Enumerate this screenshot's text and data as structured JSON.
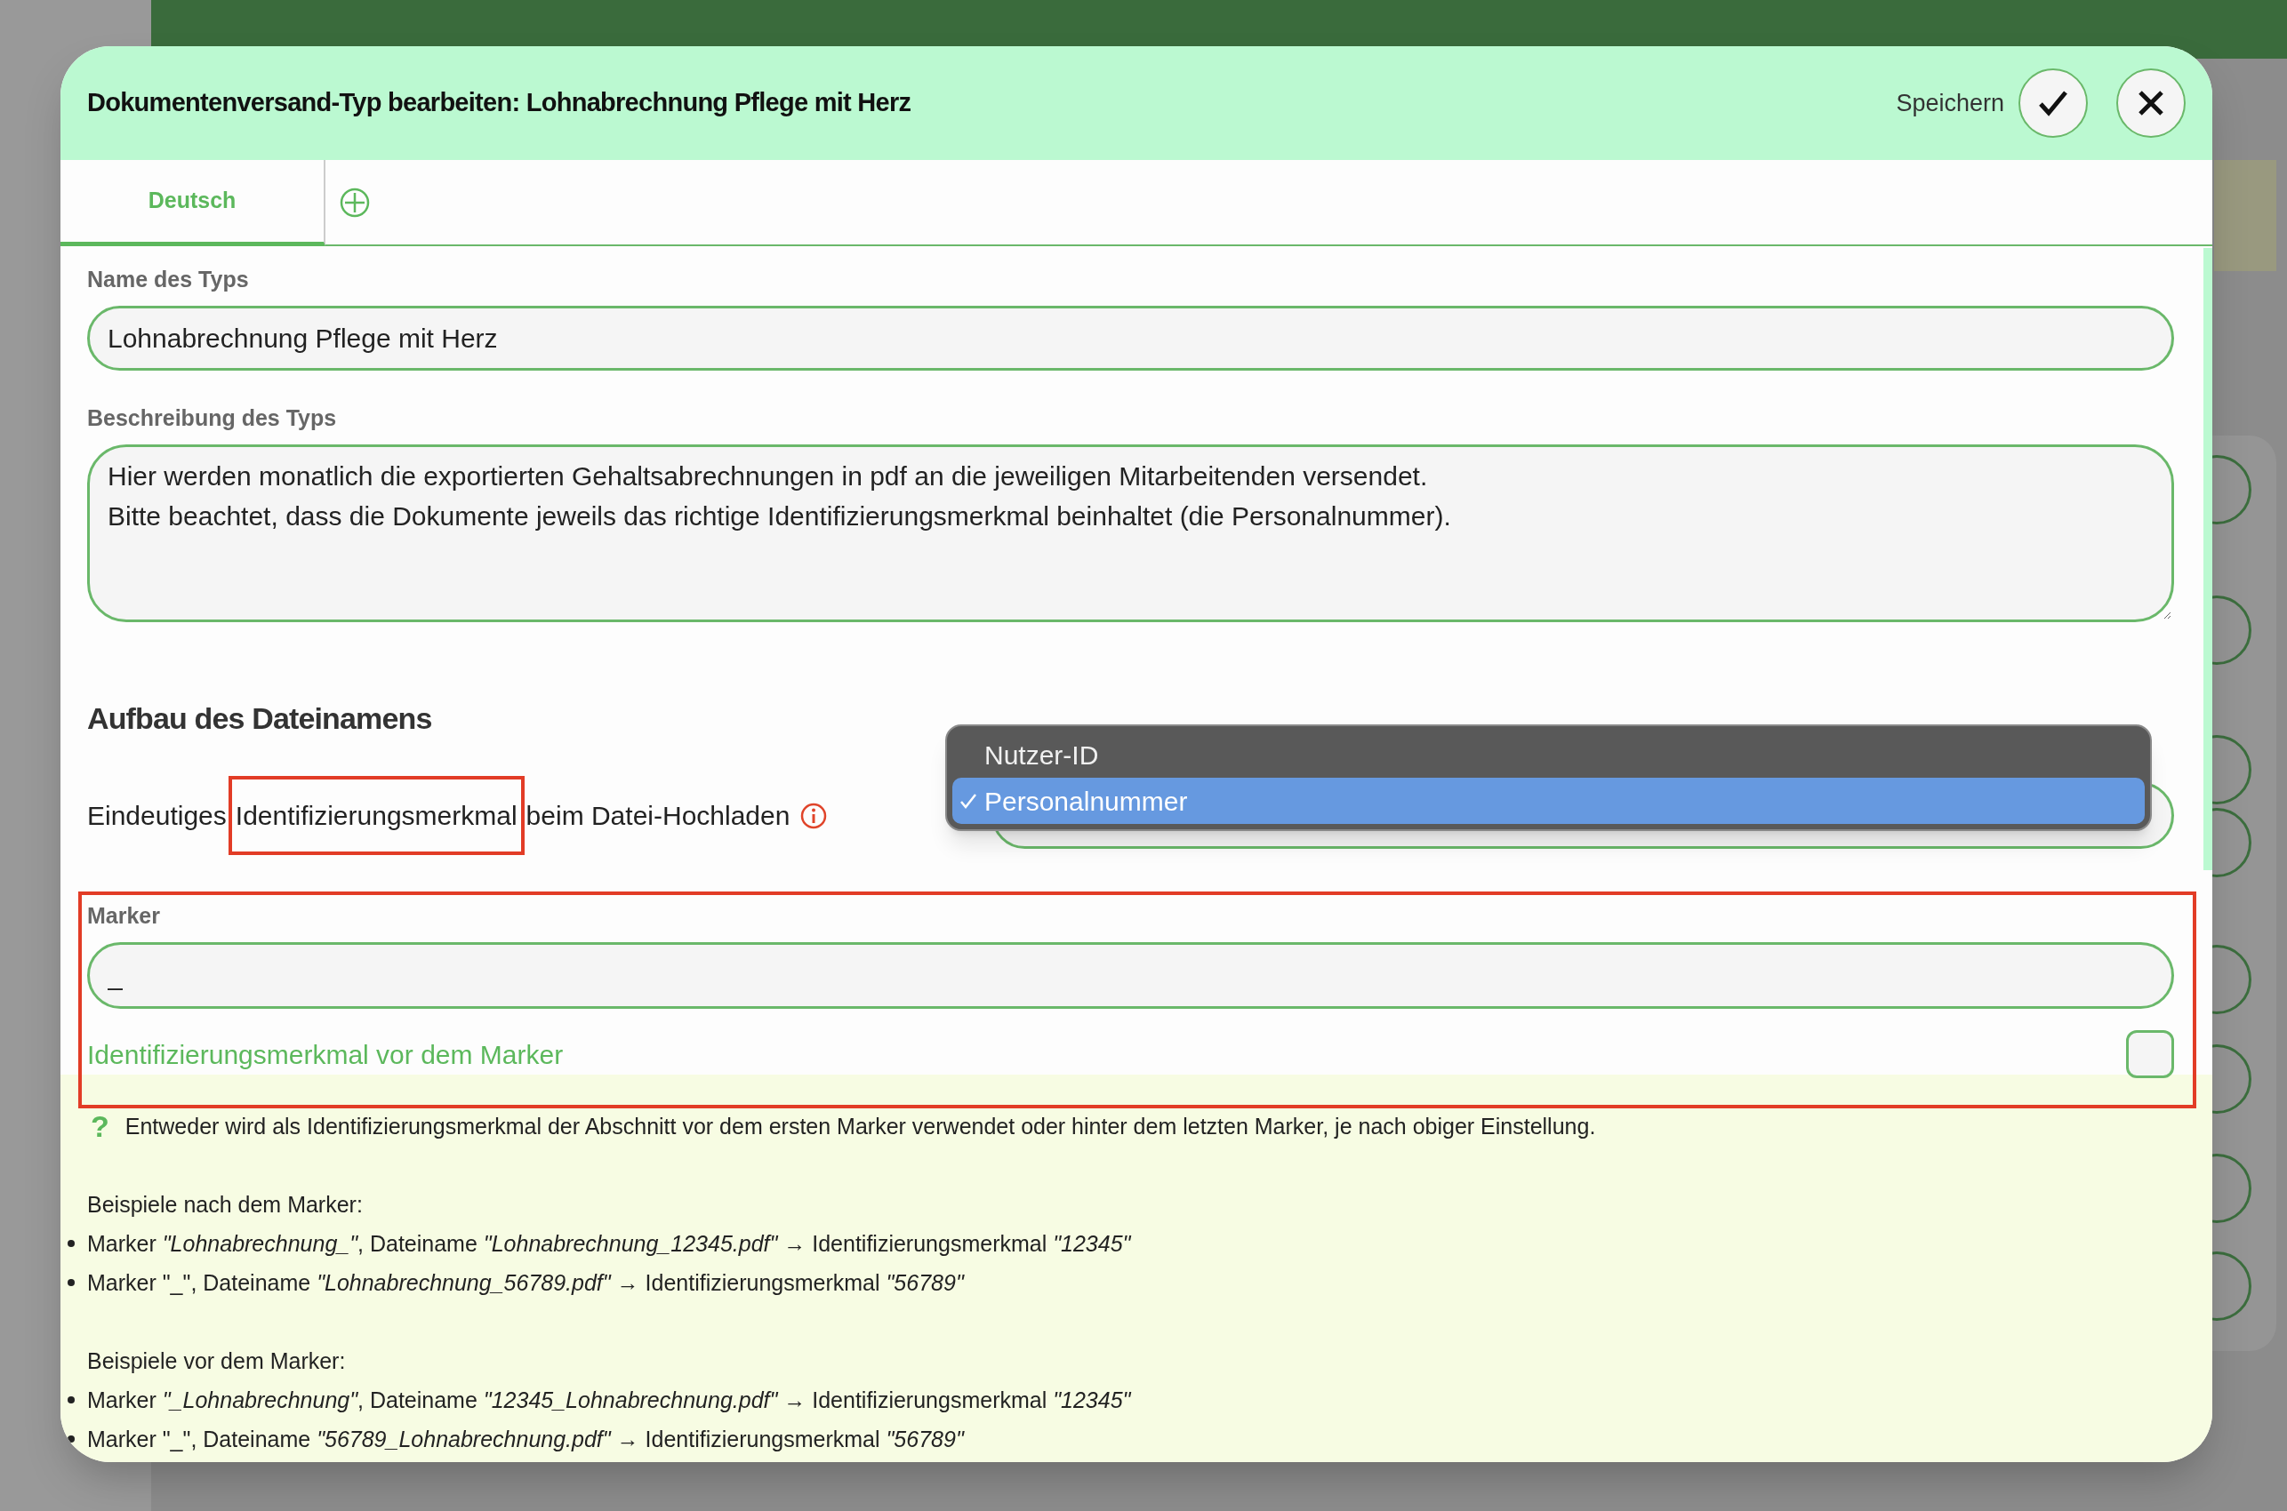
{
  "dialog": {
    "title": "Dokumentenversand-Typ bearbeiten: Lohnabrechnung Pflege mit Herz",
    "save_label": "Speichern"
  },
  "tabs": [
    {
      "label": "Deutsch",
      "selected": true
    }
  ],
  "fields": [
    {
      "kind": "input",
      "label": "Name des Typs",
      "value": "Lohnabrechnung Pflege mit Herz"
    },
    {
      "kind": "textarea",
      "label": "Beschreibung des Typs",
      "value": "Hier werden monatlich die exportierten Gehaltsabrechnungen in pdf an die jeweiligen Mitarbeitenden versendet.\nBitte beachtet, dass die Dokumente jeweils das richtige Identifizierungsmerkmal beinhaltet (die Personalnummer)."
    }
  ],
  "section_title": "Aufbau des Dateinamens",
  "identifier": {
    "label_parts": [
      {
        "text": "Eindeutiges",
        "highlighted": false
      },
      {
        "text": "Identifizierungsmerkmal",
        "highlighted": true
      },
      {
        "text": "beim Datei-Hochladen",
        "highlighted": false
      }
    ],
    "options": [
      {
        "label": "Nutzer-ID",
        "selected": false
      },
      {
        "label": "Personalnummer",
        "selected": true
      }
    ]
  },
  "marker": {
    "highlighted": true,
    "label": "Marker",
    "value": "_",
    "checkbox_label": "Identifizierungsmerkmal vor dem Marker",
    "checked": false
  },
  "help": {
    "icon": "?",
    "text": "Entweder wird als Identifizierungsmerkmal der Abschnitt vor dem ersten Marker verwendet oder hinter dem letzten Marker, je nach obiger Einstellung.",
    "groups": [
      {
        "heading": "Beispiele nach dem Marker:",
        "items": [
          "Marker *\"Lohnabrechnung_\"*, Dateiname *\"Lohnabrechnung_12345.pdf\"* → Identifizierungsmerkmal *\"12345\"*",
          "Marker \"_\", Dateiname *\"Lohnabrechnung_56789.pdf\"* → Identifizierungsmerkmal *\"56789\"*"
        ]
      },
      {
        "heading": "Beispiele vor dem Marker:",
        "items": [
          "Marker *\"_Lohnabrechnung\"*, Dateiname *\"12345_Lohnabrechnung.pdf\"* → Identifizierungsmerkmal *\"12345\"*",
          "Marker \"_\", Dateiname *\"56789_Lohnabrechnung.pdf\"* → Identifizierungsmerkmal *\"56789\"*"
        ]
      }
    ]
  }
}
